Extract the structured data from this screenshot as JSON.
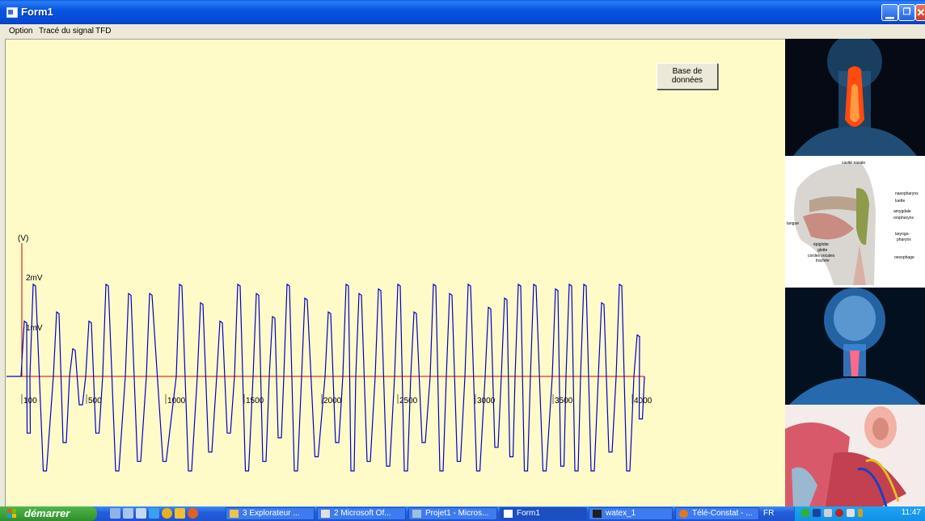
{
  "window": {
    "title": "Form1"
  },
  "menu": [
    "Option",
    "Tracé du signal",
    "TFD"
  ],
  "buttons": {
    "database": "Base de données"
  },
  "chart_data": {
    "type": "line",
    "ylabel": "(V)",
    "y_tick_labels": [
      "2mV",
      "1mV"
    ],
    "x_tick_labels": [
      "100",
      "500",
      "1000",
      "1500",
      "2000",
      "2500",
      "3000",
      "3500",
      "4000"
    ],
    "series": [
      {
        "color": "#0000cc"
      }
    ],
    "axis_color": "#cc0000"
  },
  "anatomy_labels": {
    "cavite_nasale": "cavité nasale",
    "nasopharynx": "nasopharynx",
    "luette": "luette",
    "amygdale": "amygdale",
    "oropharynx": "oropharynx",
    "langue": "langue",
    "laryngo": "laryngo-",
    "pharynx": "pharynx",
    "epiglotte": "épiglotte",
    "glotte": "glotte",
    "cordes": "cordes vocales",
    "trachee": "trachée",
    "oesophage": "oesophage"
  },
  "taskbar": {
    "start": "démarrer",
    "tasks": [
      {
        "label": "3 Explorateur ...",
        "icon": "folder-icon"
      },
      {
        "label": "2 Microsoft Of...",
        "icon": "office-icon"
      },
      {
        "label": "Projet1 - Micros...",
        "icon": "vb-icon"
      },
      {
        "label": "Form1",
        "icon": "form-icon",
        "active": true
      },
      {
        "label": "watex_1",
        "icon": "sm-icon"
      },
      {
        "label": "Télé-Constat - ...",
        "icon": "browser-icon"
      }
    ],
    "lang": "FR",
    "clock": "11:47"
  }
}
